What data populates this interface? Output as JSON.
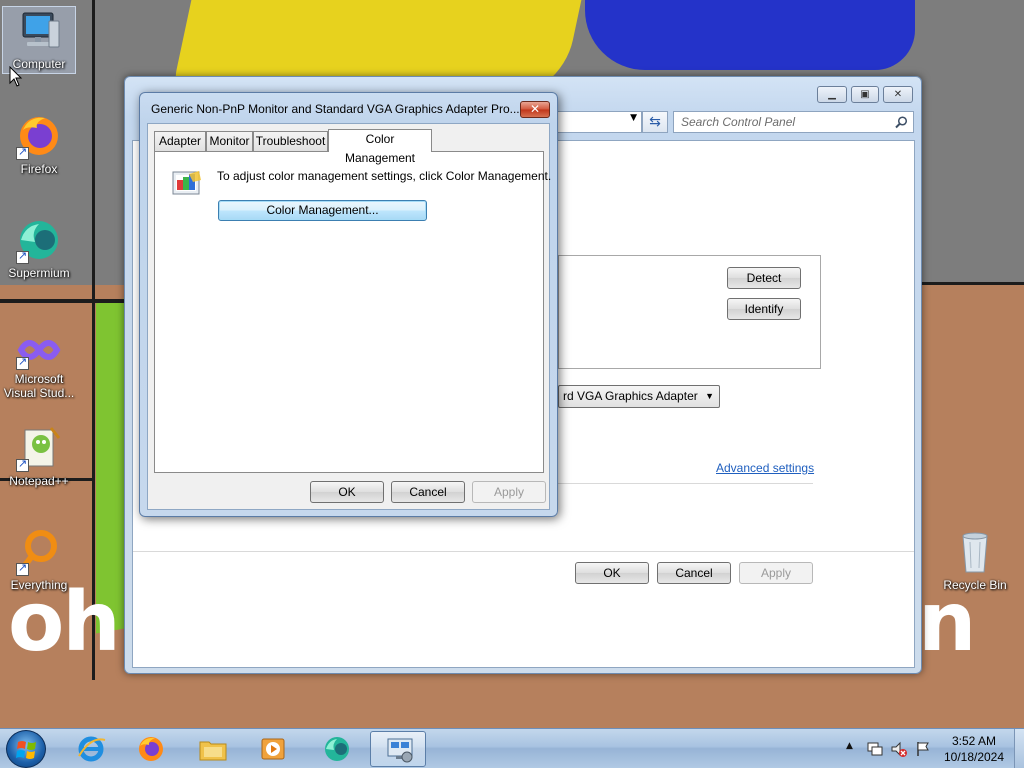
{
  "desktop": {
    "icons": [
      {
        "label": "Computer",
        "icon": "computer-icon"
      },
      {
        "label": "Firefox",
        "icon": "firefox-icon"
      },
      {
        "label": "Supermium",
        "icon": "supermium-icon"
      },
      {
        "label": "Microsoft Visual Stud...",
        "line1": "Microsoft",
        "line2": "Visual Stud...",
        "icon": "visual-studio-icon"
      },
      {
        "label": "Notepad++",
        "icon": "notepad-plus-plus-icon"
      },
      {
        "label": "Everything",
        "icon": "everything-icon"
      },
      {
        "label": "Recycle Bin",
        "icon": "recycle-bin-icon"
      }
    ],
    "wallpaper_text_left": "oh",
    "wallpaper_text_right": "n"
  },
  "back_window": {
    "search_placeholder": "Search Control Panel",
    "detect_label": "Detect",
    "identify_label": "Identify",
    "display_select_value": "rd VGA Graphics Adapter",
    "advanced_link": "Advanced settings",
    "ok_label": "OK",
    "cancel_label": "Cancel",
    "apply_label": "Apply"
  },
  "dialog": {
    "title": "Generic Non-PnP Monitor and Standard VGA Graphics Adapter Pro...",
    "close_label": "✕",
    "tabs": [
      {
        "label": "Adapter",
        "active": false
      },
      {
        "label": "Monitor",
        "active": false
      },
      {
        "label": "Troubleshoot",
        "active": false
      },
      {
        "label": "Color Management",
        "active": true
      }
    ],
    "instruction": "To adjust color management settings, click Color Management.",
    "color_management_button": "Color Management...",
    "ok_label": "OK",
    "cancel_label": "Cancel",
    "apply_label": "Apply"
  },
  "taskbar": {
    "items": [
      "internet-explorer-icon",
      "firefox-icon",
      "file-explorer-icon",
      "media-player-icon",
      "supermium-icon",
      "display-settings-icon"
    ],
    "clock_time": "3:52 AM",
    "clock_date": "10/18/2024",
    "tray_expand": "▲"
  },
  "colors": {
    "accent": "#3c7fb1",
    "close_red": "#c03519",
    "link": "#1f5fbf"
  }
}
